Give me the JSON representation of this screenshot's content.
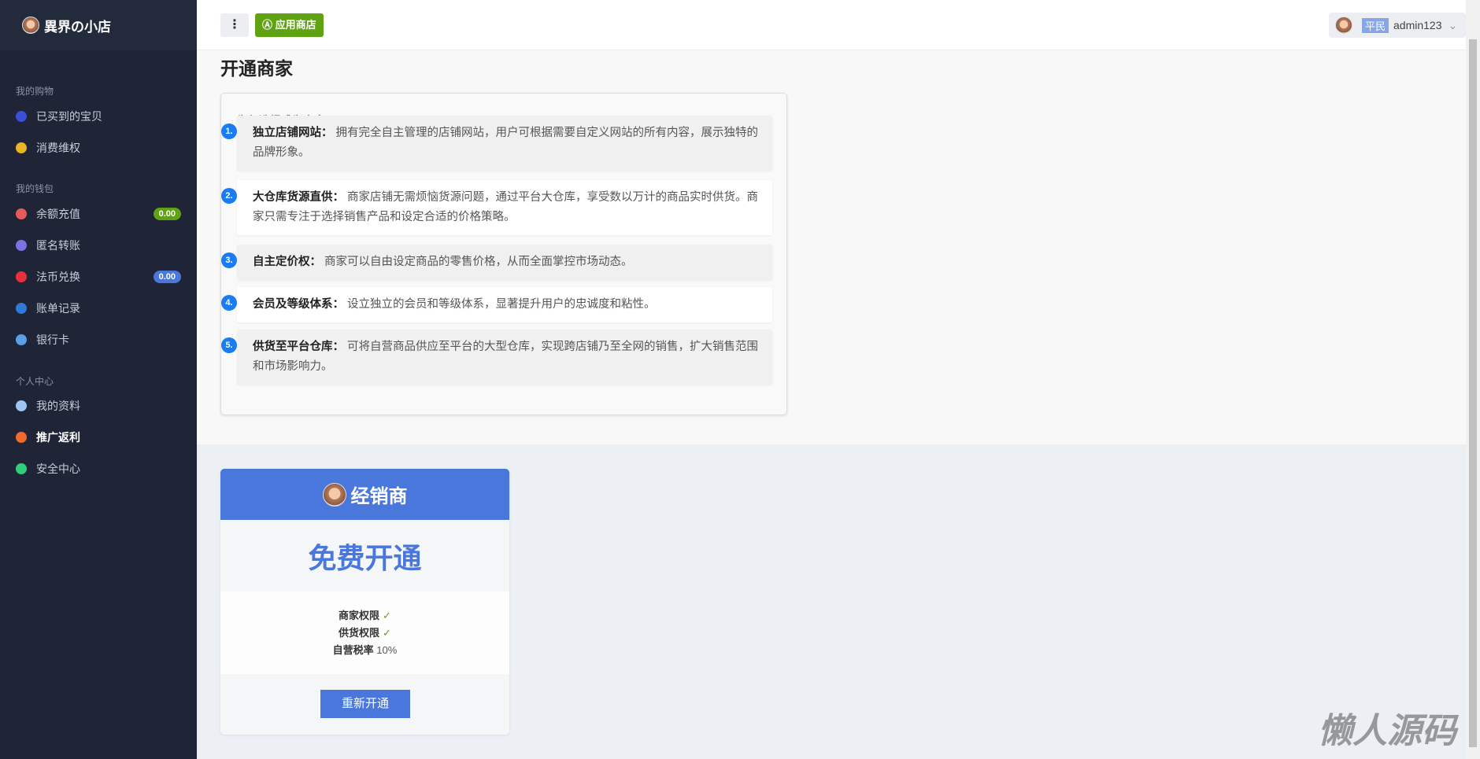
{
  "brand": "異界の小店",
  "sidebar": {
    "sections": [
      "我的购物",
      "我的钱包",
      "个人中心"
    ],
    "items": [
      {
        "label": "已买到的宝贝",
        "icon": "orders-icon",
        "color": "#3b4fd6"
      },
      {
        "label": "消费维权",
        "icon": "rights-icon",
        "color": "#e8b524"
      },
      {
        "label": "余额充值",
        "icon": "recharge-icon",
        "color": "#e55a5a",
        "badge": "0.00",
        "badge_color": "#5fa313"
      },
      {
        "label": "匿名转账",
        "icon": "transfer-icon",
        "color": "#7a72e6"
      },
      {
        "label": "法币兑换",
        "icon": "exchange-icon",
        "color": "#e8303b",
        "badge": "0.00",
        "badge_color": "#4a77dc"
      },
      {
        "label": "账单记录",
        "icon": "bill-icon",
        "color": "#2f7ad8"
      },
      {
        "label": "银行卡",
        "icon": "bankcard-icon",
        "color": "#5aa0e6"
      },
      {
        "label": "我的资料",
        "icon": "user-icon",
        "color": "#9cc4f5"
      },
      {
        "label": "推广返利",
        "icon": "send-icon",
        "color": "#f06a2a"
      },
      {
        "label": "安全中心",
        "icon": "shield-icon",
        "color": "#2fcf7a"
      }
    ]
  },
  "header": {
    "menu": "⋮",
    "app_store": "应用商店",
    "rank": "平民",
    "username": "admin123"
  },
  "page_title": "开通商家",
  "why": {
    "question": "为何选择成为商家?",
    "features": [
      {
        "n": "1.",
        "title": "独立店铺网站：",
        "text": "拥有完全自主管理的店铺网站，用户可根据需要自定义网站的所有内容，展示独特的品牌形象。"
      },
      {
        "n": "2.",
        "title": "大仓库货源直供：",
        "text": "商家店铺无需烦恼货源问题，通过平台大仓库，享受数以万计的商品实时供货。商家只需专注于选择销售产品和设定合适的价格策略。"
      },
      {
        "n": "3.",
        "title": "自主定价权：",
        "text": "商家可以自由设定商品的零售价格，从而全面掌控市场动态。"
      },
      {
        "n": "4.",
        "title": "会员及等级体系：",
        "text": "设立独立的会员和等级体系，显著提升用户的忠诚度和粘性。"
      },
      {
        "n": "5.",
        "title": "供货至平台仓库：",
        "text": "可将自营商品供应至平台的大型仓库，实现跨店铺乃至全网的销售，扩大销售范围和市场影响力。"
      }
    ]
  },
  "plan": {
    "name": "经销商",
    "price": "免费开通",
    "perm1": "商家权限",
    "perm2": "供货权限",
    "tax_label": "自营税率",
    "tax_value": "10%",
    "button": "重新开通"
  },
  "watermark": "懒人源码"
}
